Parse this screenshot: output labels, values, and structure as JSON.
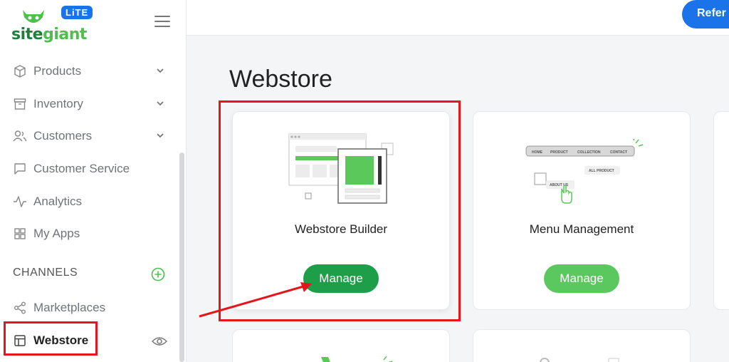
{
  "logo": {
    "brand_site": "site",
    "brand_giant": "giant",
    "badge": "LiTE"
  },
  "sidebar": {
    "items": [
      {
        "label": "Products",
        "icon": "box-icon",
        "chevron": true
      },
      {
        "label": "Inventory",
        "icon": "archive-icon",
        "chevron": true
      },
      {
        "label": "Customers",
        "icon": "users-icon",
        "chevron": true
      },
      {
        "label": "Customer Service",
        "icon": "chat-icon",
        "chevron": false
      },
      {
        "label": "Analytics",
        "icon": "pulse-icon",
        "chevron": false
      },
      {
        "label": "My Apps",
        "icon": "grid-icon",
        "chevron": false
      }
    ],
    "channels_title": "CHANNELS",
    "channel_items": [
      {
        "label": "Marketplaces",
        "icon": "share-icon"
      },
      {
        "label": "Webstore",
        "icon": "layout-icon"
      }
    ]
  },
  "topbar": {
    "refer_label": "Refer"
  },
  "main": {
    "title": "Webstore",
    "cards": [
      {
        "label": "Webstore Builder",
        "button": "Manage"
      },
      {
        "label": "Menu Management",
        "button": "Manage"
      }
    ],
    "menu_illustration": {
      "nav": [
        "HOME",
        "PRODUCT",
        "COLLECTION",
        "CONTACT"
      ],
      "all_product": "ALL PRODUCT",
      "about_us": "ABOUT US"
    }
  },
  "colors": {
    "accent_green": "#1e9e48",
    "light_green": "#5ac85f",
    "highlight_red": "#e5161b",
    "brand_blue": "#1a73e8"
  }
}
